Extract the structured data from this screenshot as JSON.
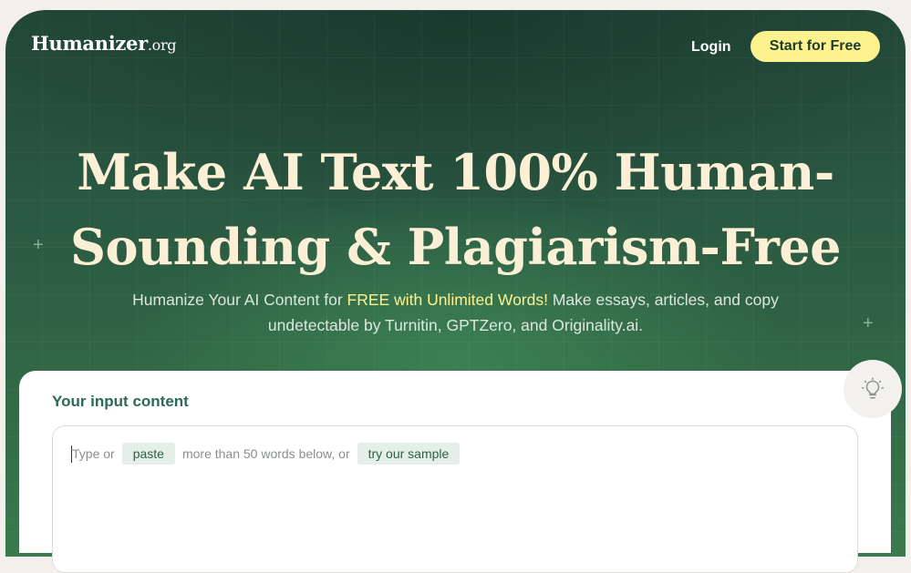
{
  "header": {
    "logo_name": "Humanizer",
    "logo_tld": ".org",
    "login_label": "Login",
    "cta_label": "Start for Free"
  },
  "hero": {
    "headline_line1": "Make AI Text 100% Human-",
    "headline_line2": "Sounding & Plagiarism-Free",
    "subtitle_pre": "Humanize Your AI Content for ",
    "subtitle_highlight": "FREE with Unlimited Words!",
    "subtitle_post": " Make essays, articles, and copy undetectable by Turnitin, GPTZero, and Originality.ai."
  },
  "input_card": {
    "title": "Your input content",
    "hint_type": "Type or",
    "paste_label": "paste",
    "hint_middle": "more than 50 words below, or",
    "sample_label": "try our sample"
  },
  "icons": {
    "tip": "lightbulb-icon",
    "sparkle": "sparkle-icon"
  },
  "colors": {
    "hero_green": "#2b5a42",
    "headline_cream": "#fbefd6",
    "cta_yellow": "#fdf28e",
    "title_teal": "#2a6a5a",
    "chip_bg": "#e4efe9"
  }
}
